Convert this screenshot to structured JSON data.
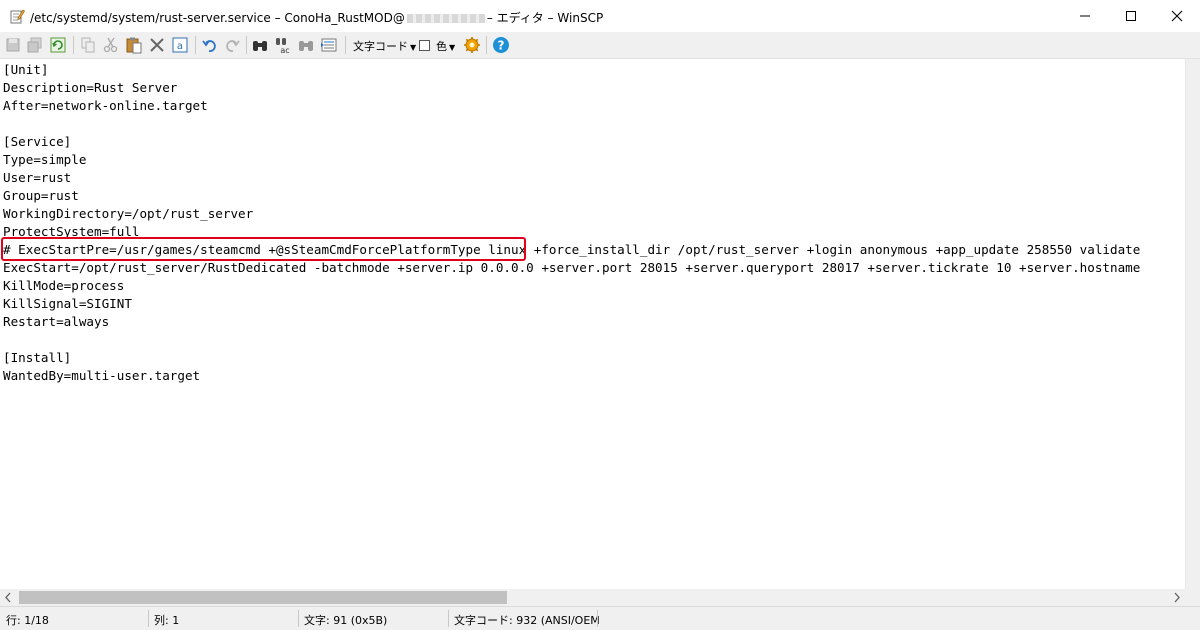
{
  "window": {
    "title_prefix": "/etc/systemd/system/rust-server.service – ConoHa_RustMOD@",
    "title_suffix": "– エディタ – WinSCP"
  },
  "toolbar": {
    "encoding_label": "文字コード",
    "color_label": "色"
  },
  "editor": {
    "lines": [
      "[Unit]",
      "Description=Rust Server",
      "After=network-online.target",
      "",
      "[Service]",
      "Type=simple",
      "User=rust",
      "Group=rust",
      "WorkingDirectory=/opt/rust_server",
      "ProtectSystem=full",
      "# ExecStartPre=/usr/games/steamcmd +@sSteamCmdForcePlatformType linux +force_install_dir /opt/rust_server +login anonymous +app_update 258550 validate",
      "ExecStart=/opt/rust_server/RustDedicated -batchmode +server.ip 0.0.0.0 +server.port 28015 +server.queryport 28017 +server.tickrate 10 +server.hostname",
      "KillMode=process",
      "KillSignal=SIGINT",
      "Restart=always",
      "",
      "[Install]",
      "WantedBy=multi-user.target"
    ]
  },
  "status": {
    "line": "行: 1/18",
    "column": "列: 1",
    "char": "文字: 91 (0x5B)",
    "encoding": "文字コード: 932  (ANSI/OEM"
  },
  "colors": {
    "highlight_border": "#e0001a",
    "help_icon": "#1e90d8",
    "gear_icon": "#f0a000"
  }
}
